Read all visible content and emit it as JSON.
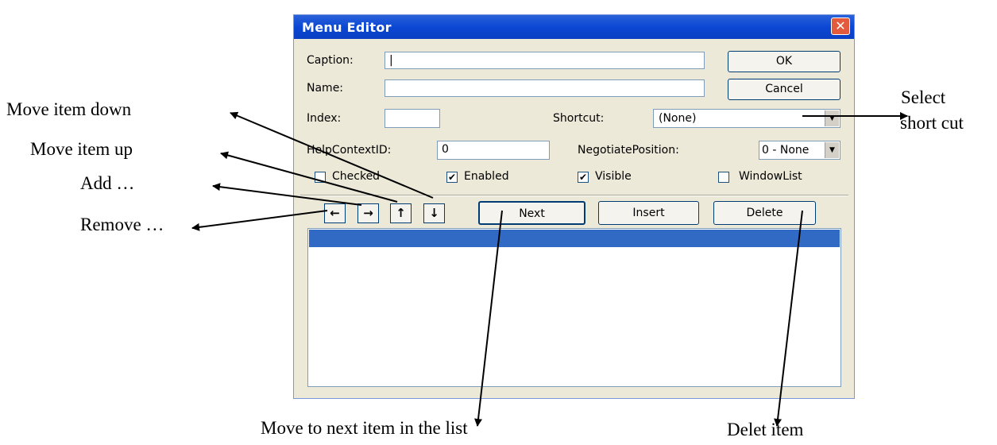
{
  "dialog": {
    "title": "Menu Editor",
    "close_glyph": "✕",
    "caption_label": "Caption:",
    "caption_value": "|",
    "name_label": "Name:",
    "name_value": "",
    "index_label": "Index:",
    "index_value": "",
    "shortcut_label": "Shortcut:",
    "shortcut_value": "(None)",
    "helpcontext_label": "HelpContextID:",
    "helpcontext_value": "0",
    "negotiate_label": "NegotiatePosition:",
    "negotiate_value": "0 - None",
    "checkboxes": [
      {
        "label": "Checked",
        "checked": false
      },
      {
        "label": "Enabled",
        "checked": true
      },
      {
        "label": "Visible",
        "checked": true
      },
      {
        "label": "WindowList",
        "checked": false
      }
    ],
    "ok_label": "OK",
    "cancel_label": "Cancel",
    "next_label": "Next",
    "insert_label": "Insert",
    "delete_label": "Delete",
    "arrow_buttons": [
      "←",
      "→",
      "↑",
      "↓"
    ]
  },
  "annotations": {
    "move_down": "Move item down",
    "move_up": "Move item up",
    "add": "Add …",
    "remove": "Remove …",
    "select_shortcut_1": "Select",
    "select_shortcut_2": "short cut",
    "next_item": "Move to next item in the list",
    "delete_item": "Delet item"
  },
  "colors": {
    "titlebar": "#0b47d4",
    "dialog_bg": "#ece9d8",
    "selection": "#316ac5",
    "close_button": "#e35a3c"
  }
}
